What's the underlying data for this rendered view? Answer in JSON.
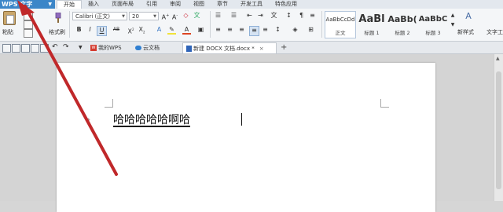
{
  "menu": {
    "app_button": "WPS 文字",
    "tabs": [
      "开始",
      "插入",
      "页面布局",
      "引用",
      "审阅",
      "视图",
      "章节",
      "开发工具",
      "特色应用"
    ],
    "active_tab": "开始"
  },
  "ribbon": {
    "paste_label": "粘贴",
    "format_painter_label": "格式刷",
    "font_name": "Calibri (正文)",
    "font_size": "20",
    "styles": [
      {
        "sample": "AaBbCcDd",
        "name": "正文"
      },
      {
        "sample": "AaBl",
        "name": "标题 1"
      },
      {
        "sample": "AaBb(",
        "name": "标题 2"
      },
      {
        "sample": "AaBbC",
        "name": "标题 3"
      }
    ],
    "new_style_label": "新样式",
    "text_tools_label": "文字工"
  },
  "doc_tabs": [
    {
      "label": "我的WPS",
      "active": false
    },
    {
      "label": "云文档",
      "active": false
    },
    {
      "label": "新建 DOCX 文档.docx *",
      "active": true
    }
  ],
  "document": {
    "text": "哈哈哈哈哈啊哈"
  },
  "annotation": {
    "color": "#c0282a"
  }
}
